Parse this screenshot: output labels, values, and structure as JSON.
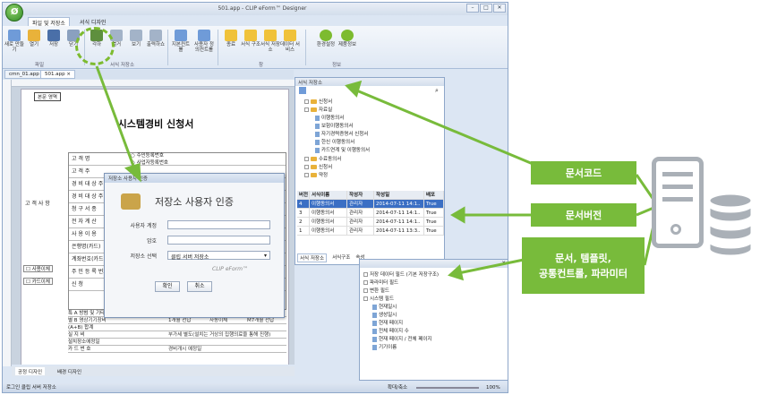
{
  "app": {
    "title": "501.app - CLIP eForm™ Designer",
    "win_buttons": [
      "–",
      "□",
      "✕"
    ]
  },
  "ribbon_tabs": [
    "파일 및 저장소",
    "서식 디자인"
  ],
  "ribbon": {
    "buttons": [
      "새로 만들기",
      "열기",
      "저장",
      "닫기",
      "각하",
      "열거",
      "보기",
      "출력하쇼",
      "지본컨트롤",
      "사용자 정의컨트롤",
      "종료",
      "서식 구조",
      "서식 저장소",
      "데이터 서비스",
      "환경설정",
      "제품정보"
    ],
    "groups": [
      "파일",
      "서식 저장소",
      "창",
      "정보"
    ]
  },
  "doc_tabs": [
    "cmn_01.app",
    "501.app ×"
  ],
  "document": {
    "label": "본문 영역",
    "title": "시스템경비 신청서",
    "left_label": "고 객 사 항",
    "rows": [
      "고 객 명",
      "고 객 주",
      "경 비 대 상 주",
      "경 비 대 상 주",
      "청 구 서 종",
      "전 자 계 산",
      "사 용 이 용",
      "은행명(카드)",
      "계좌번호(카드번호)",
      "주 민 등 록 번호",
      "신 청"
    ],
    "checks": [
      "사용이체",
      "카드이체"
    ],
    "radios": [
      "주민등록번호",
      "사업자등록번호"
    ],
    "bottom_rows": [
      "특 A 방범 및 기타",
      "별 B 영상기기장비",
      "(A+B) 합계",
      "실 지 비",
      "설치장소에정일",
      "카 드 번 호"
    ],
    "bottom_right": [
      "1개월 선납",
      "자동이체",
      "M7개월 선납",
      "부가세 별도(설치는 거상의 집행의료을 통해 진행)",
      "경비개시 예정일"
    ]
  },
  "login": {
    "bar": "저장소 사용자 인증",
    "heading": "저장소 사용자 인증",
    "id_label": "사용자 계정",
    "pw_label": "암호",
    "repo_label": "저장소 선택",
    "repo_value": "클립 서버 저장소",
    "brand": "CLIP eForm™",
    "ok": "확인",
    "cancel": "취소"
  },
  "repo_panel": {
    "title": "서식 저장소",
    "tree": [
      "신청서",
      "자료실",
      "이행동의서",
      "보험이행동의서",
      "자기경력증명서 신청서",
      "한신 이행동의서",
      "카드연계 및 이행동의서",
      "수료동의서",
      "신청서",
      "약정"
    ],
    "columns": [
      "버전",
      "서식이름",
      "작성자",
      "작성일",
      "배포"
    ],
    "rows": [
      [
        "4",
        "이행동의서",
        "관리자",
        "2014-07-11 14:1..",
        "True"
      ],
      [
        "3",
        "이행동의서",
        "관리자",
        "2014-07-11 14:1..",
        "True"
      ],
      [
        "2",
        "이행동의서",
        "관리자",
        "2014-07-11 14:1..",
        "True"
      ],
      [
        "1",
        "이행동의서",
        "관리자",
        "2014-07-11 13:3..",
        "True"
      ]
    ],
    "tabs": [
      "서식 저장소",
      "서식구조",
      "속성"
    ]
  },
  "struct_panel": {
    "tree": [
      "저장 데이터 필드 (기본 저장구조)",
      "파라미터 필드",
      "변환 필드",
      "시스템 필드",
      "현재일시",
      "생성일시",
      "현재 페이지",
      "전체 페이지 수",
      "현재 페이지 / 전체 페이지",
      "기기이름"
    ]
  },
  "bottom_tabs": [
    "공정 디자인",
    "배경 디자인"
  ],
  "status": {
    "left": "로그인 클립 서버 저장소",
    "zoom_label": "확대/축소",
    "zoom": "100%"
  },
  "callouts": {
    "code": "문서코드",
    "version": "문서버전",
    "resources_1": "문서, 템플릿,",
    "resources_2": "공통컨트롤, 파라미터"
  },
  "colors": {
    "accent": "#78bb3b",
    "window": "#dce6f3",
    "selected": "#3b6fc4",
    "server": "#aab0b7"
  }
}
